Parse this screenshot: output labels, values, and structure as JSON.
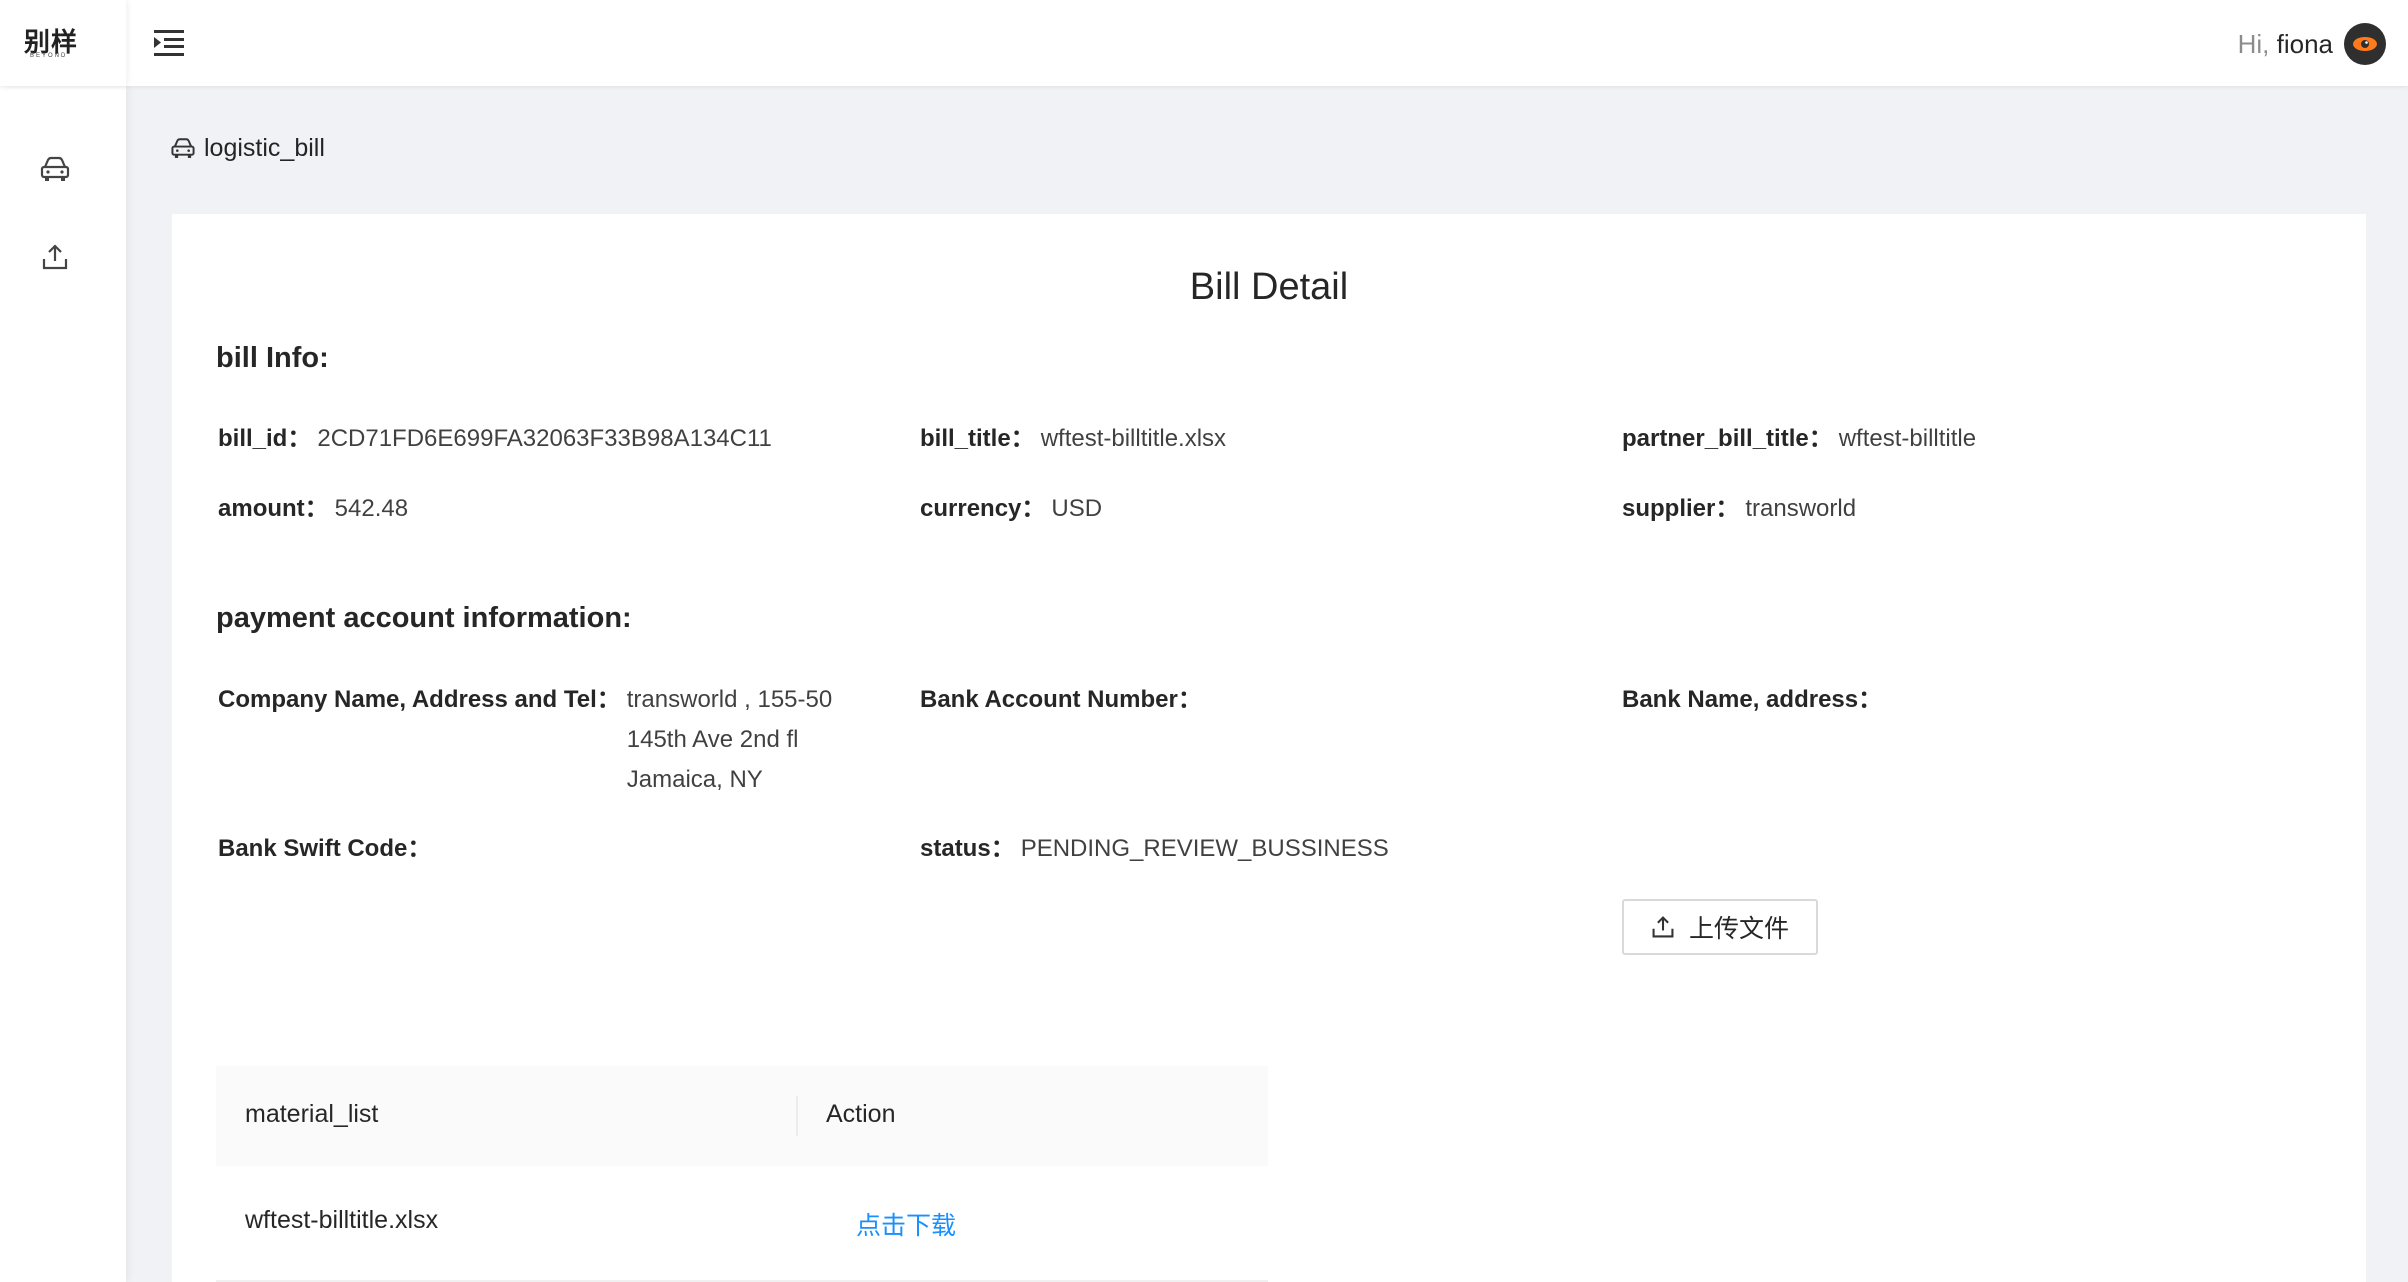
{
  "header": {
    "logo_cn": "别样",
    "logo_en": "BEYOND",
    "greeting_prefix": "Hi,",
    "username": "fiona"
  },
  "colors": {
    "link": "#1890ff",
    "background": "#f0f2f5",
    "avatar": "#2f2f2f",
    "avatar_eye": "#ff7a1a"
  },
  "sidebar": {
    "items": [
      {
        "icon": "car-icon"
      },
      {
        "icon": "upload-icon"
      }
    ]
  },
  "breadcrumb": {
    "label": "logistic_bill",
    "icon": "car-icon"
  },
  "page": {
    "title": "Bill Detail"
  },
  "bill_info": {
    "section_title": "bill Info:",
    "bill_id": {
      "label": "bill_id：",
      "value": "2CD71FD6E699FA32063F33B98A134C11"
    },
    "bill_title": {
      "label": "bill_title：",
      "value": "wftest-billtitle.xlsx"
    },
    "partner_bill_title": {
      "label": "partner_bill_title：",
      "value": "wftest-billtitle"
    },
    "amount": {
      "label": "amount：",
      "value": "542.48"
    },
    "currency": {
      "label": "currency：",
      "value": "USD"
    },
    "supplier": {
      "label": "supplier：",
      "value": "transworld"
    }
  },
  "payment": {
    "section_title": "payment account information:",
    "company": {
      "label": "Company Name, Address and Tel：",
      "value": "transworld , 155-50 145th Ave 2nd fl Jamaica, NY"
    },
    "bank_account": {
      "label": "Bank Account Number：",
      "value": ""
    },
    "bank_name": {
      "label": "Bank Name, address：",
      "value": ""
    },
    "swift": {
      "label": "Bank Swift Code：",
      "value": ""
    },
    "status": {
      "label": "status：",
      "value": "PENDING_REVIEW_BUSSINESS"
    }
  },
  "upload": {
    "label": "上传文件"
  },
  "material_table": {
    "columns": [
      "material_list",
      "Action"
    ],
    "rows": [
      {
        "name": "wftest-billtitle.xlsx",
        "action": "点击下载"
      }
    ]
  }
}
